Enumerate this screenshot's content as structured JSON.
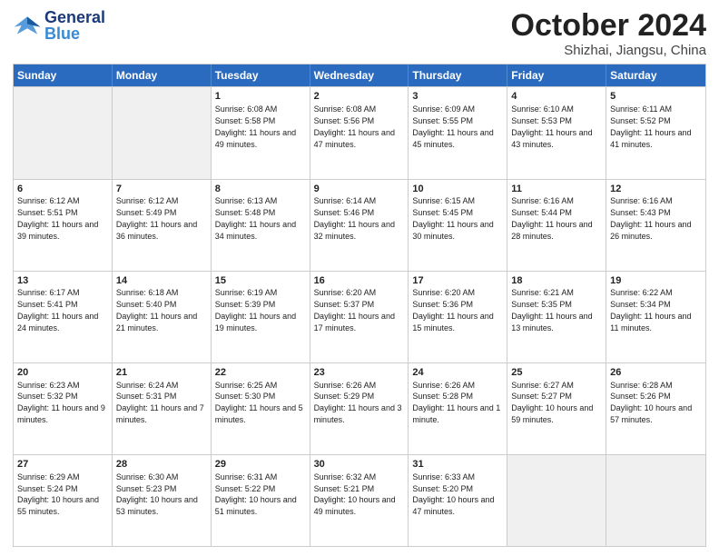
{
  "header": {
    "logo": {
      "general": "General",
      "blue": "Blue"
    },
    "title": "October 2024",
    "location": "Shizhai, Jiangsu, China"
  },
  "days_of_week": [
    "Sunday",
    "Monday",
    "Tuesday",
    "Wednesday",
    "Thursday",
    "Friday",
    "Saturday"
  ],
  "weeks": [
    [
      {
        "day": "",
        "info": "",
        "shaded": true
      },
      {
        "day": "",
        "info": "",
        "shaded": true
      },
      {
        "day": "1",
        "info": "Sunrise: 6:08 AM\nSunset: 5:58 PM\nDaylight: 11 hours and 49 minutes.",
        "shaded": false
      },
      {
        "day": "2",
        "info": "Sunrise: 6:08 AM\nSunset: 5:56 PM\nDaylight: 11 hours and 47 minutes.",
        "shaded": false
      },
      {
        "day": "3",
        "info": "Sunrise: 6:09 AM\nSunset: 5:55 PM\nDaylight: 11 hours and 45 minutes.",
        "shaded": false
      },
      {
        "day": "4",
        "info": "Sunrise: 6:10 AM\nSunset: 5:53 PM\nDaylight: 11 hours and 43 minutes.",
        "shaded": false
      },
      {
        "day": "5",
        "info": "Sunrise: 6:11 AM\nSunset: 5:52 PM\nDaylight: 11 hours and 41 minutes.",
        "shaded": false
      }
    ],
    [
      {
        "day": "6",
        "info": "Sunrise: 6:12 AM\nSunset: 5:51 PM\nDaylight: 11 hours and 39 minutes.",
        "shaded": false
      },
      {
        "day": "7",
        "info": "Sunrise: 6:12 AM\nSunset: 5:49 PM\nDaylight: 11 hours and 36 minutes.",
        "shaded": false
      },
      {
        "day": "8",
        "info": "Sunrise: 6:13 AM\nSunset: 5:48 PM\nDaylight: 11 hours and 34 minutes.",
        "shaded": false
      },
      {
        "day": "9",
        "info": "Sunrise: 6:14 AM\nSunset: 5:46 PM\nDaylight: 11 hours and 32 minutes.",
        "shaded": false
      },
      {
        "day": "10",
        "info": "Sunrise: 6:15 AM\nSunset: 5:45 PM\nDaylight: 11 hours and 30 minutes.",
        "shaded": false
      },
      {
        "day": "11",
        "info": "Sunrise: 6:16 AM\nSunset: 5:44 PM\nDaylight: 11 hours and 28 minutes.",
        "shaded": false
      },
      {
        "day": "12",
        "info": "Sunrise: 6:16 AM\nSunset: 5:43 PM\nDaylight: 11 hours and 26 minutes.",
        "shaded": false
      }
    ],
    [
      {
        "day": "13",
        "info": "Sunrise: 6:17 AM\nSunset: 5:41 PM\nDaylight: 11 hours and 24 minutes.",
        "shaded": false
      },
      {
        "day": "14",
        "info": "Sunrise: 6:18 AM\nSunset: 5:40 PM\nDaylight: 11 hours and 21 minutes.",
        "shaded": false
      },
      {
        "day": "15",
        "info": "Sunrise: 6:19 AM\nSunset: 5:39 PM\nDaylight: 11 hours and 19 minutes.",
        "shaded": false
      },
      {
        "day": "16",
        "info": "Sunrise: 6:20 AM\nSunset: 5:37 PM\nDaylight: 11 hours and 17 minutes.",
        "shaded": false
      },
      {
        "day": "17",
        "info": "Sunrise: 6:20 AM\nSunset: 5:36 PM\nDaylight: 11 hours and 15 minutes.",
        "shaded": false
      },
      {
        "day": "18",
        "info": "Sunrise: 6:21 AM\nSunset: 5:35 PM\nDaylight: 11 hours and 13 minutes.",
        "shaded": false
      },
      {
        "day": "19",
        "info": "Sunrise: 6:22 AM\nSunset: 5:34 PM\nDaylight: 11 hours and 11 minutes.",
        "shaded": false
      }
    ],
    [
      {
        "day": "20",
        "info": "Sunrise: 6:23 AM\nSunset: 5:32 PM\nDaylight: 11 hours and 9 minutes.",
        "shaded": false
      },
      {
        "day": "21",
        "info": "Sunrise: 6:24 AM\nSunset: 5:31 PM\nDaylight: 11 hours and 7 minutes.",
        "shaded": false
      },
      {
        "day": "22",
        "info": "Sunrise: 6:25 AM\nSunset: 5:30 PM\nDaylight: 11 hours and 5 minutes.",
        "shaded": false
      },
      {
        "day": "23",
        "info": "Sunrise: 6:26 AM\nSunset: 5:29 PM\nDaylight: 11 hours and 3 minutes.",
        "shaded": false
      },
      {
        "day": "24",
        "info": "Sunrise: 6:26 AM\nSunset: 5:28 PM\nDaylight: 11 hours and 1 minute.",
        "shaded": false
      },
      {
        "day": "25",
        "info": "Sunrise: 6:27 AM\nSunset: 5:27 PM\nDaylight: 10 hours and 59 minutes.",
        "shaded": false
      },
      {
        "day": "26",
        "info": "Sunrise: 6:28 AM\nSunset: 5:26 PM\nDaylight: 10 hours and 57 minutes.",
        "shaded": false
      }
    ],
    [
      {
        "day": "27",
        "info": "Sunrise: 6:29 AM\nSunset: 5:24 PM\nDaylight: 10 hours and 55 minutes.",
        "shaded": false
      },
      {
        "day": "28",
        "info": "Sunrise: 6:30 AM\nSunset: 5:23 PM\nDaylight: 10 hours and 53 minutes.",
        "shaded": false
      },
      {
        "day": "29",
        "info": "Sunrise: 6:31 AM\nSunset: 5:22 PM\nDaylight: 10 hours and 51 minutes.",
        "shaded": false
      },
      {
        "day": "30",
        "info": "Sunrise: 6:32 AM\nSunset: 5:21 PM\nDaylight: 10 hours and 49 minutes.",
        "shaded": false
      },
      {
        "day": "31",
        "info": "Sunrise: 6:33 AM\nSunset: 5:20 PM\nDaylight: 10 hours and 47 minutes.",
        "shaded": false
      },
      {
        "day": "",
        "info": "",
        "shaded": true
      },
      {
        "day": "",
        "info": "",
        "shaded": true
      }
    ]
  ]
}
